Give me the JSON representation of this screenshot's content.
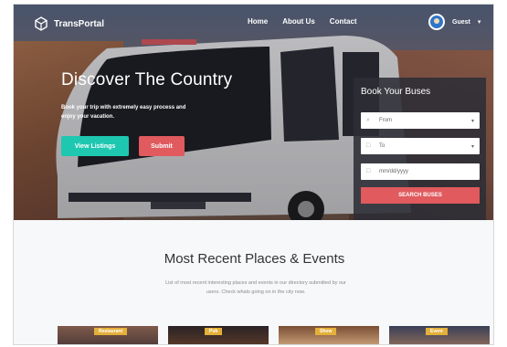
{
  "nav": {
    "brand": "TransPortal",
    "links": [
      "Home",
      "About Us",
      "Contact"
    ],
    "user_name": "Guest"
  },
  "hero": {
    "title": "Discover The Country",
    "description": "Book your trip with extremely easy process and enjoy your vacation.",
    "primary_button": "View Listings",
    "secondary_button": "Submit"
  },
  "booking": {
    "title": "Book Your Buses",
    "from_placeholder": "From",
    "to_placeholder": "To",
    "date_placeholder": "mm/dd/yyyy",
    "search_button": "SEARCH BUSES"
  },
  "section": {
    "title": "Most Recent Places & Events",
    "description": "List of most recent interesting places and events in our directory submitted by our users. Check whats going on in the city now."
  },
  "cards": [
    {
      "badge": "Restaurant"
    },
    {
      "badge": "Pub"
    },
    {
      "badge": "Show"
    },
    {
      "badge": "Event"
    }
  ],
  "colors": {
    "teal": "#1ec7b0",
    "red": "#e05a5e",
    "badge": "#e5b03a"
  },
  "icons": {
    "brand": "cube-logo-icon",
    "from": "location-icon",
    "to": "location-icon",
    "date": "calendar-icon",
    "dropdown": "caret-down-icon"
  }
}
